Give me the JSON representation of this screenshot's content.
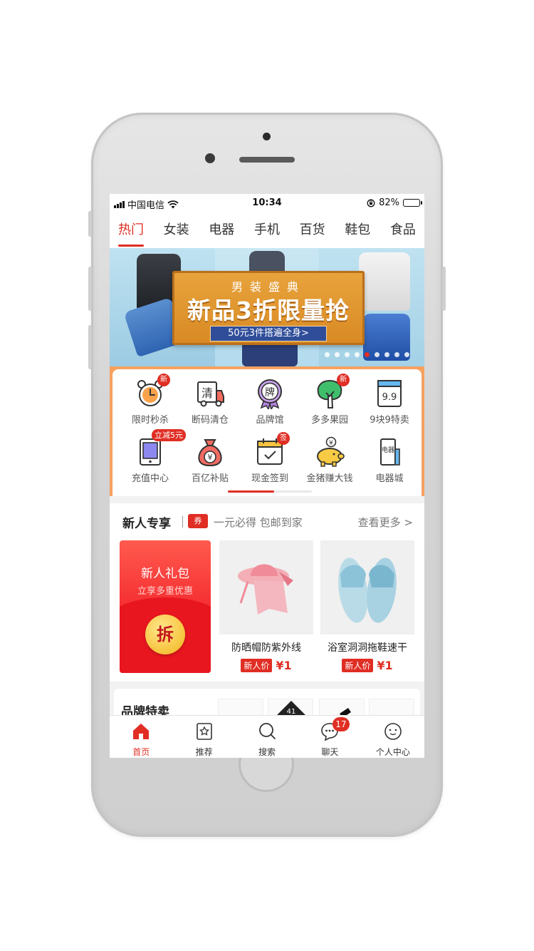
{
  "status_bar": {
    "carrier": "中国电信",
    "time": "10:34",
    "battery": "82%",
    "battery_level": 0.82
  },
  "category_tabs": [
    {
      "label": "热门",
      "active": true
    },
    {
      "label": "女装"
    },
    {
      "label": "电器"
    },
    {
      "label": "手机"
    },
    {
      "label": "百货"
    },
    {
      "label": "鞋包"
    },
    {
      "label": "食品"
    }
  ],
  "banner": {
    "subtitle": "男装盛典",
    "headline": "新品3折限量抢",
    "promo": "50元3件搭遍全身>",
    "slide_count": 9,
    "active_slide": 4
  },
  "quick_grid": {
    "items": [
      {
        "label": "限时秒杀",
        "icon": "alarm-clock-icon",
        "badge": "新"
      },
      {
        "label": "断码清仓",
        "icon": "clearance-truck-icon",
        "glyph": "清"
      },
      {
        "label": "品牌馆",
        "icon": "brand-medal-icon",
        "glyph": "牌"
      },
      {
        "label": "多多果园",
        "icon": "fruit-tree-icon",
        "badge": "新"
      },
      {
        "label": "9块9特卖",
        "icon": "calendar-99-icon",
        "glyph": "9.9"
      },
      {
        "label": "充值中心",
        "icon": "tablet-icon",
        "coupon": "立减5元"
      },
      {
        "label": "百亿补贴",
        "icon": "money-bag-icon",
        "glyph": "¥"
      },
      {
        "label": "现金签到",
        "icon": "calendar-check-icon",
        "badge": "签"
      },
      {
        "label": "金猪赚大钱",
        "icon": "piggy-bank-icon",
        "glyph": "¥"
      },
      {
        "label": "电器城",
        "icon": "appliance-icon",
        "glyph": "电器"
      }
    ],
    "scroll_progress": 0.55
  },
  "new_user": {
    "title": "新人专享",
    "ticket": "券",
    "slogan": "一元必得 包邮到家",
    "more": "查看更多 >",
    "gift": {
      "title": "新人礼包",
      "subtitle": "立享多重优惠",
      "button": "拆"
    },
    "products": [
      {
        "name": "防晒帽防紫外线",
        "tag": "新人价",
        "price": "¥1"
      },
      {
        "name": "浴室洞洞拖鞋速干",
        "tag": "新人价",
        "price": "¥1"
      }
    ]
  },
  "brand_section": {
    "title": "品牌特卖",
    "logo_text": "41"
  },
  "tab_bar": [
    {
      "label": "首页",
      "icon": "home-icon",
      "active": true
    },
    {
      "label": "推荐",
      "icon": "recommend-icon"
    },
    {
      "label": "搜索",
      "icon": "search-icon"
    },
    {
      "label": "聊天",
      "icon": "chat-icon",
      "badge": "17"
    },
    {
      "label": "个人中心",
      "icon": "profile-icon"
    }
  ],
  "colors": {
    "accent": "#e02e24",
    "banner_sign": "#e39a32",
    "grid_frame": "#f7a15f"
  }
}
